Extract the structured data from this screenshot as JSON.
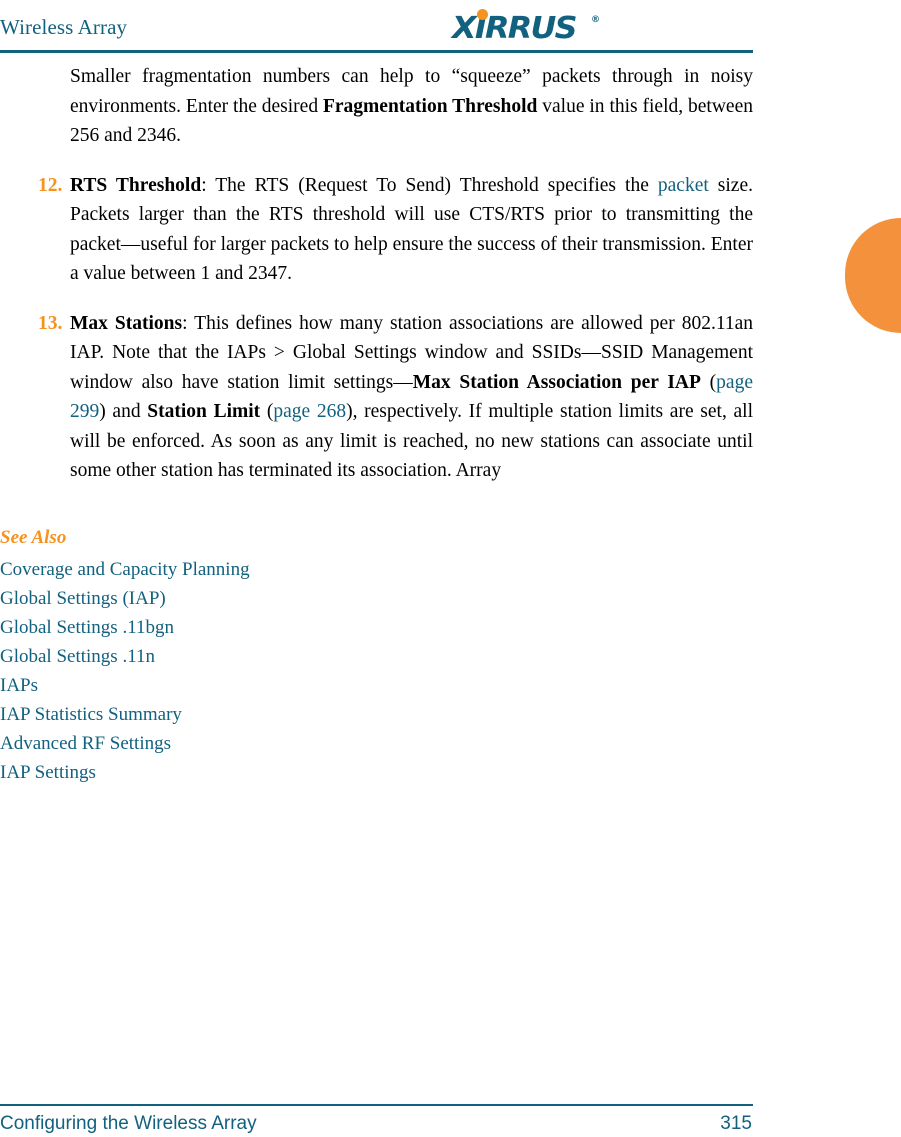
{
  "header": {
    "title": "Wireless Array",
    "logo": {
      "wordmark": "XIRRUS",
      "registered_mark": "®",
      "dot_color": "#f6921e",
      "text_color": "#12617f"
    },
    "rule_color": "#12617f"
  },
  "content": {
    "intro_paragraph": {
      "segment_1": "Smaller fragmentation numbers can help to “squeeze” packets through in noisy environments. Enter the desired ",
      "bold_1": "Fragmentation Threshold",
      "segment_2": " value in this field, between 256 and 2346."
    },
    "list_items": [
      {
        "marker": "12.",
        "bold_term": "RTS Threshold",
        "segment_1": ": The RTS (Request To Send) Threshold specifies the ",
        "link_1": "packet",
        "segment_2": " size. Packets larger than the RTS threshold will use CTS/RTS prior to transmitting the packet—useful for larger packets to help ensure the success of their transmission. Enter a value between 1 and 2347."
      },
      {
        "marker": "13.",
        "bold_term": "Max Stations",
        "segment_1": ": This defines how many station associations are allowed per 802.11an IAP. Note that the IAPs > Global Settings window and SSIDs—SSID Management window also have station limit settings—",
        "bold_2": "Max Station Association per IAP",
        "segment_2": " (",
        "link_1": "page 299",
        "segment_3": ") and ",
        "bold_3": "Station Limit",
        "segment_4": " (",
        "link_2": "page 268",
        "segment_5": "), respectively. If multiple station limits are set, all will be enforced. As soon as any limit is reached, no new stations can associate until some other station has terminated its association. Array"
      }
    ]
  },
  "see_also": {
    "heading": "See Also",
    "links": [
      "Coverage and Capacity Planning",
      "Global Settings (IAP)",
      "Global Settings .11bgn",
      "Global Settings .11n",
      "IAPs",
      "IAP Statistics Summary",
      "Advanced RF Settings",
      "IAP Settings"
    ]
  },
  "edge_tab": {
    "color": "#f4913c"
  },
  "footer": {
    "title": "Configuring the Wireless Array",
    "page_number": "315",
    "rule_color": "#12617f"
  },
  "colors": {
    "accent_orange": "#f6921e",
    "brand_teal": "#12617f",
    "body_text": "#000000"
  }
}
